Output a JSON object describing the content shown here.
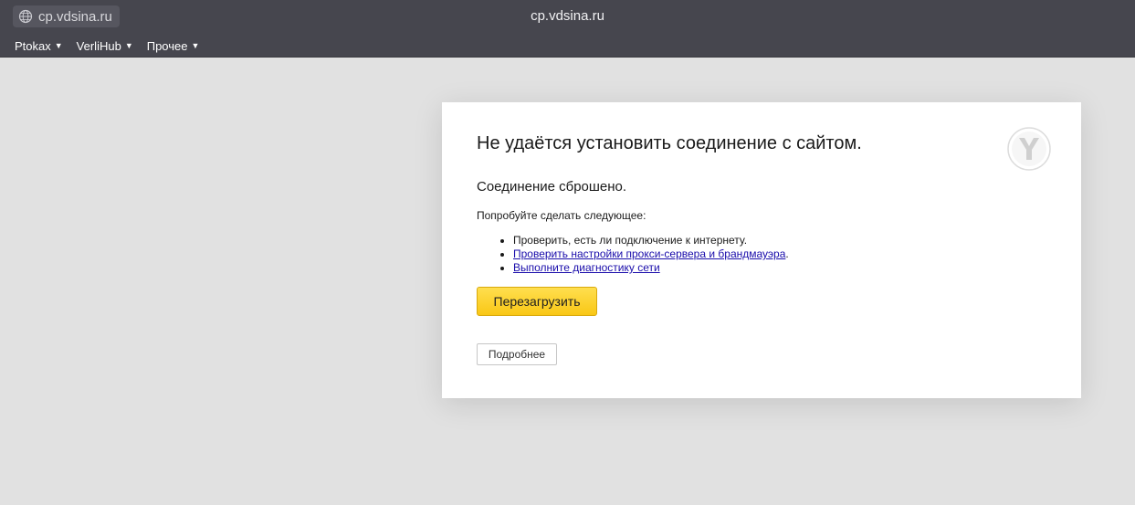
{
  "browser": {
    "url": "cp.vdsina.ru",
    "window_title": "cp.vdsina.ru",
    "bookmarks": [
      {
        "label": "Ptokax"
      },
      {
        "label": "VerliHub"
      },
      {
        "label": "Прочее"
      }
    ]
  },
  "error": {
    "title": "Не удаётся установить соединение с сайтом.",
    "subtitle": "Соединение сброшено.",
    "try_text": "Попробуйте сделать следующее:",
    "suggestions": [
      {
        "text": "Проверить, есть ли подключение к интернету."
      },
      {
        "link": "Проверить настройки прокси-сервера и брандмауэра",
        "suffix": "."
      },
      {
        "link": "Выполните диагностику сети"
      }
    ],
    "reload_label": "Перезагрузить",
    "details_label": "Подробнее"
  },
  "colors": {
    "topbar": "#46464e",
    "page_bg": "#e1e1e1",
    "reload_button": "#fdd835",
    "link": "#1a0dab"
  },
  "icons": {
    "url_icon": "globe-icon",
    "brand": "yandex-browser-logo-icon"
  }
}
